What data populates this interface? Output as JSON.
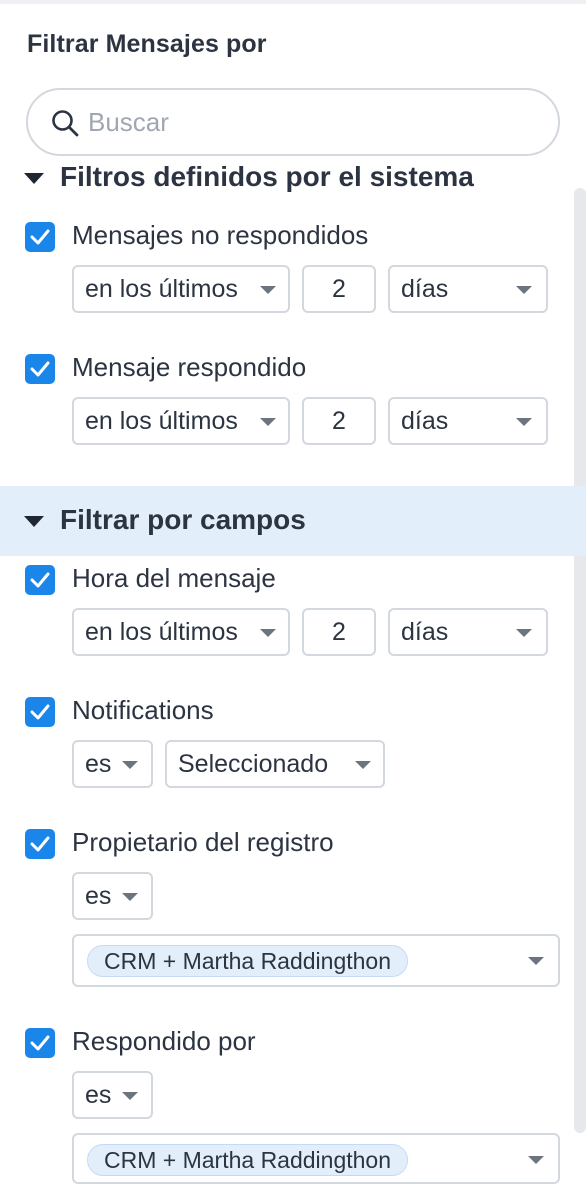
{
  "panel": {
    "title": "Filtrar Mensajes por"
  },
  "search": {
    "placeholder": "Buscar"
  },
  "sections": {
    "system": {
      "label": "Filtros definidos por el sistema"
    },
    "fields": {
      "label": "Filtrar por campos"
    }
  },
  "filters": {
    "unanswered": {
      "label": "Mensajes no respondidos",
      "checked": true,
      "operator": "en los últimos",
      "value": "2",
      "unit": "días"
    },
    "answered": {
      "label": "Mensaje respondido",
      "checked": true,
      "operator": "en los últimos",
      "value": "2",
      "unit": "días"
    },
    "message_time": {
      "label": "Hora del mensaje",
      "checked": true,
      "operator": "en los últimos",
      "value": "2",
      "unit": "días"
    },
    "notifications": {
      "label": "Notifications",
      "checked": true,
      "operator": "es",
      "value": "Seleccionado"
    },
    "record_owner": {
      "label": "Propietario del registro",
      "checked": true,
      "operator": "es",
      "chip": "CRM + Martha Raddingthon"
    },
    "replied_by": {
      "label": "Respondido por",
      "checked": true,
      "operator": "es",
      "chip": "CRM + Martha Raddingthon"
    }
  },
  "colors": {
    "accent": "#1a86ea",
    "section_highlight": "#e3eefb",
    "text": "#2c3442",
    "border": "#d3d7de"
  }
}
